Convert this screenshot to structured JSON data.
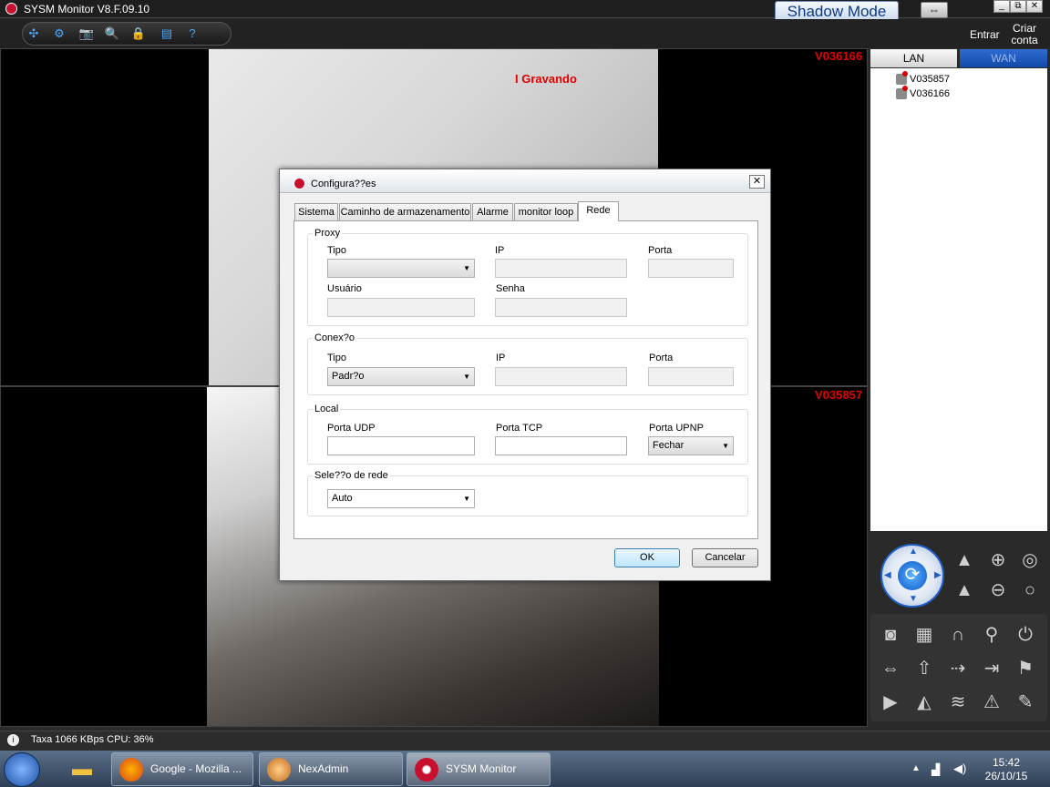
{
  "window": {
    "title": "SYSM Monitor  V8.F.09.10",
    "shadow_mode_label": "Shadow Mode",
    "swap_icon": "⇔",
    "min_icon": "_",
    "restore_icon": "⧉",
    "close_icon": "✕"
  },
  "toolbar": {
    "icons": [
      "✣",
      "⚙",
      "📷",
      "🔍",
      "🔒",
      "▤",
      "?"
    ],
    "entrar": "Entrar",
    "criar_conta": "Criar conta"
  },
  "video": {
    "recording_label": "I Gravando",
    "top_cam_id": "V036166",
    "bottom_cam_id": "V035857"
  },
  "right_panel": {
    "tab_lan": "LAN",
    "tab_wan": "WAN",
    "devices": [
      "V035857",
      "V036166"
    ]
  },
  "status": {
    "icon": "i",
    "text": "Taxa 1066 KBps  CPU:  36%"
  },
  "taskbar": {
    "tasks": [
      "Google - Mozilla ...",
      "NexAdmin",
      "SYSM Monitor"
    ],
    "time": "15:42",
    "date": "26/10/15"
  },
  "dialog": {
    "title": "Configura??es",
    "close_icon": "✕",
    "tabs": [
      "Sistema",
      "Caminho de armazenamento",
      "Alarme",
      "monitor loop",
      "Rede"
    ],
    "active_tab": "Rede",
    "proxy": {
      "group": "Proxy",
      "tipo_label": "Tipo",
      "tipo_value": "",
      "ip_label": "IP",
      "porta_label": "Porta",
      "usuario_label": "Usuário",
      "senha_label": "Senha"
    },
    "conexao": {
      "group": "Conex?o",
      "tipo_label": "Tipo",
      "tipo_value": "Padr?o",
      "ip_label": "IP",
      "porta_label": "Porta"
    },
    "local": {
      "group": "Local",
      "udp_label": "Porta UDP",
      "tcp_label": "Porta TCP",
      "upnp_label": "Porta UPNP",
      "upnp_value": "Fechar"
    },
    "selecao": {
      "group": "Sele??o de rede",
      "value": "Auto"
    },
    "ok_label": "OK",
    "cancel_label": "Cancelar"
  },
  "colors": {
    "accent_blue": "#1e5fc8",
    "record_red": "#e00000",
    "brand_red": "#c8102e"
  }
}
